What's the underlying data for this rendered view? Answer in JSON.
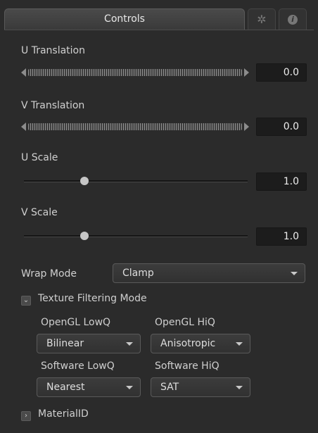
{
  "header": {
    "title": "Controls",
    "settings_icon": "gear-icon",
    "info_icon": "info-icon",
    "info_glyph": "i"
  },
  "u_translation": {
    "label": "U Translation",
    "value": "0.0"
  },
  "v_translation": {
    "label": "V Translation",
    "value": "0.0"
  },
  "u_scale": {
    "label": "U Scale",
    "value": "1.0",
    "slider_fraction": 0.27
  },
  "v_scale": {
    "label": "V Scale",
    "value": "1.0",
    "slider_fraction": 0.27
  },
  "wrap_mode": {
    "label": "Wrap Mode",
    "selected": "Clamp"
  },
  "texture_filtering": {
    "label": "Texture Filtering Mode",
    "expanded": true,
    "opengl_lowq": {
      "label": "OpenGL LowQ",
      "selected": "Bilinear"
    },
    "opengl_hiq": {
      "label": "OpenGL HiQ",
      "selected": "Anisotropic"
    },
    "software_lowq": {
      "label": "Software LowQ",
      "selected": "Nearest"
    },
    "software_hiq": {
      "label": "Software HiQ",
      "selected": "SAT"
    }
  },
  "material_id": {
    "label": "MaterialID",
    "expanded": false
  }
}
